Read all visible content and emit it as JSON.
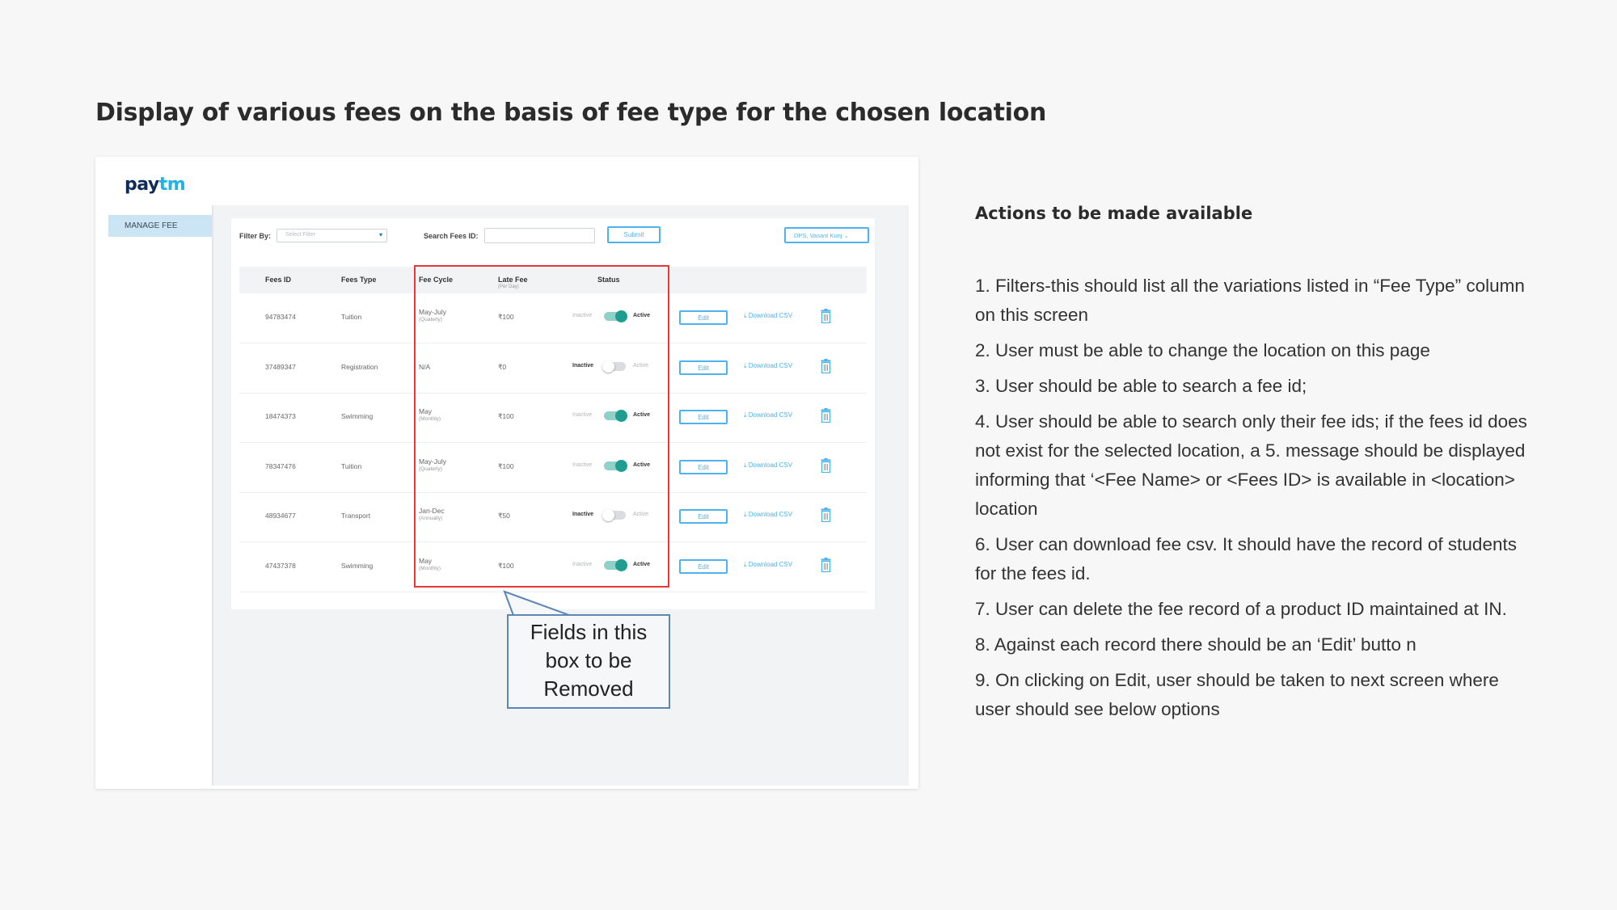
{
  "page_title": "Display of various fees on the basis of fee type for the chosen location",
  "mockup": {
    "logo": {
      "pay": "pay",
      "tm": "tm"
    },
    "sidebar": {
      "manage_fee": "MANAGE FEE"
    },
    "filters": {
      "filter_label": "Filter By:",
      "filter_placeholder": "Select Filter",
      "search_label": "Search Fees ID:",
      "submit_label": "Submit",
      "location_label": "DPS, Vasant Kunj"
    },
    "table": {
      "headers": {
        "fees_id": "Fees ID",
        "fees_type": "Fees Type",
        "fee_cycle": "Fee Cycle",
        "late_fee": "Late Fee",
        "late_fee_sub": "(Per Day)",
        "status": "Status"
      },
      "status_labels": {
        "inactive": "Inactive",
        "active": "Active"
      },
      "edit_label": "Edit",
      "download_label": "Download CSV",
      "rows": [
        {
          "id": "94783474",
          "type": "Tuition",
          "cycle": "May-July",
          "cycle_sub": "(Quaterly)",
          "late_fee": "₹100",
          "active": true
        },
        {
          "id": "37489347",
          "type": "Registration",
          "cycle": "N/A",
          "cycle_sub": "",
          "late_fee": "₹0",
          "active": false
        },
        {
          "id": "18474373",
          "type": "Swimming",
          "cycle": "May",
          "cycle_sub": "(Monthly)",
          "late_fee": "₹100",
          "active": true
        },
        {
          "id": "78347476",
          "type": "Tuition",
          "cycle": "May-July",
          "cycle_sub": "(Quaterly)",
          "late_fee": "₹100",
          "active": true
        },
        {
          "id": "48934677",
          "type": "Transport",
          "cycle": "Jan-Dec",
          "cycle_sub": "(Annually)",
          "late_fee": "₹50",
          "active": false
        },
        {
          "id": "47437378",
          "type": "Swimming",
          "cycle": "May",
          "cycle_sub": "(Monthly)",
          "late_fee": "₹100",
          "active": true
        }
      ]
    },
    "callout": {
      "line1": "Fields in this",
      "line2": "box to be",
      "line3": "Removed"
    }
  },
  "actions": {
    "title": "Actions to be made available",
    "items": [
      "1. Filters-this should list all the variations listed in “Fee Type” column on this screen",
      "2. User must be able to change the location on this page",
      "3. User should be able to search a fee id;",
      "4. User should be able to search only their fee ids;  if the fees id does not exist for the selected location, a 5. message should be displayed informing that ‘<Fee Name> or <Fees ID> is available in <location> location",
      "6. User can download fee csv. It should have the record of students for the fees id.",
      "7. User can delete the fee record of a product ID maintained at IN.",
      "8. Against each record there should be an ‘Edit’ butto n",
      "9. On clicking on Edit, user should be taken to next screen where user should see below options"
    ]
  },
  "colors": {
    "accent": "#4fb2ec",
    "toggle_on": "#1f9e90",
    "highlight_box": "#e5383b",
    "callout_border": "#5c86b8"
  }
}
